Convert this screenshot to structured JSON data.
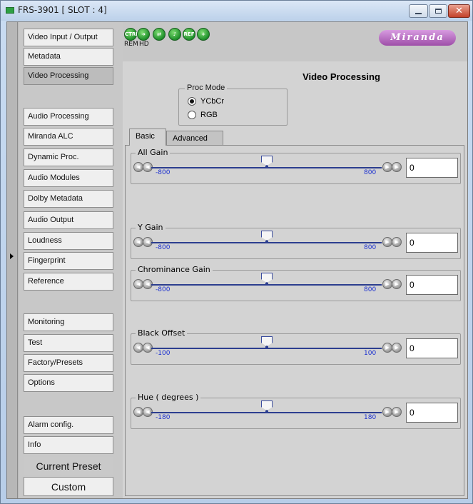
{
  "window": {
    "title": "FRS-3901 [ SLOT : 4]"
  },
  "sidebar": {
    "items": [
      {
        "label": "Video Input / Output"
      },
      {
        "label": "Metadata"
      },
      {
        "label": "Video Processing",
        "active": true
      },
      {
        "label": "Audio Processing"
      },
      {
        "label": "Miranda ALC"
      },
      {
        "label": "Dynamic Proc."
      },
      {
        "label": "Audio Modules"
      },
      {
        "label": "Dolby Metadata"
      },
      {
        "label": "Audio Output"
      },
      {
        "label": "Loudness"
      },
      {
        "label": "Fingerprint"
      },
      {
        "label": "Reference"
      },
      {
        "label": "Monitoring"
      },
      {
        "label": "Test"
      },
      {
        "label": "Factory/Presets"
      },
      {
        "label": "Options"
      },
      {
        "label": "Alarm config."
      },
      {
        "label": "Info"
      }
    ],
    "current_preset_label": "Current Preset",
    "current_preset_value": "Custom"
  },
  "toolbar": {
    "icons": [
      "ctrl-icon",
      "hd-icon",
      "source-icon",
      "audio-icon",
      "ref-icon",
      "plus-icon"
    ],
    "ctrl_text": "CTRL",
    "ref_text": "REF",
    "rem_label": "REM",
    "hd_label": "HD",
    "brand": "Miranda"
  },
  "main": {
    "heading": "Video Processing",
    "proc_mode": {
      "legend": "Proc Mode",
      "options": [
        "YCbCr",
        "RGB"
      ],
      "selected": "YCbCr"
    },
    "tabs": [
      {
        "label": "Basic",
        "active": true
      },
      {
        "label": "Advanced",
        "active": false
      }
    ],
    "sliders": [
      {
        "label": "All Gain",
        "min": "-800",
        "max": "800",
        "value": "0",
        "position": 0.5
      },
      {
        "label": "Y Gain",
        "min": "-800",
        "max": "800",
        "value": "0",
        "position": 0.5
      },
      {
        "label": "Chrominance Gain",
        "min": "-800",
        "max": "800",
        "value": "0",
        "position": 0.5
      },
      {
        "label": "Black Offset",
        "min": "-100",
        "max": "100",
        "value": "0",
        "position": 0.5
      },
      {
        "label": "Hue ( degrees )",
        "min": "-180",
        "max": "180",
        "value": "0",
        "position": 0.5
      }
    ]
  },
  "colors": {
    "accent_green": "#1e8f2a",
    "brand_purple": "#9e4ea8",
    "slider_track": "#2c3e8f",
    "range_label": "#1a2fd0"
  }
}
